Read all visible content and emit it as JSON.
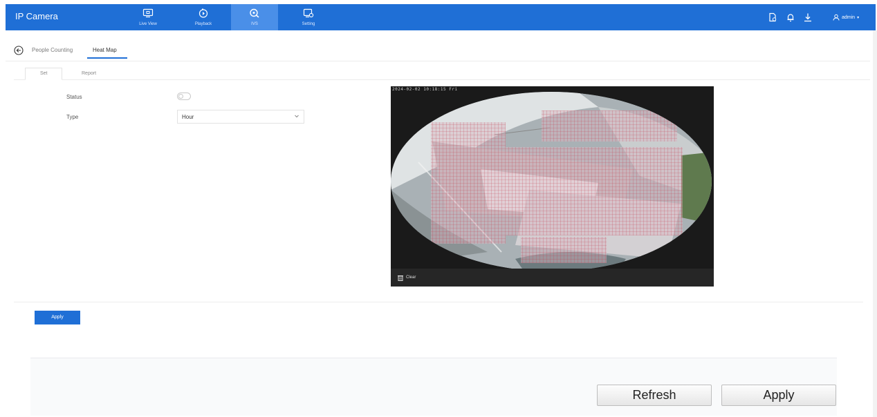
{
  "app": {
    "title": "IP Camera"
  },
  "nav": [
    {
      "label": "Live View",
      "icon": "monitor-icon",
      "active": false
    },
    {
      "label": "Playback",
      "icon": "playback-icon",
      "active": false
    },
    {
      "label": "IVS",
      "icon": "ivs-icon",
      "active": true
    },
    {
      "label": "Setting",
      "icon": "setting-icon",
      "active": false
    }
  ],
  "header_icons": [
    "file-icon",
    "bell-icon",
    "download-icon"
  ],
  "user": {
    "name": "admin",
    "icon": "user-icon"
  },
  "breadcrumb": {
    "items": [
      "People Counting",
      "Heat Map"
    ],
    "active": "Heat Map"
  },
  "subtabs": {
    "items": [
      "Set",
      "Report"
    ],
    "active": "Set"
  },
  "form": {
    "status_label": "Status",
    "status_on": false,
    "type_label": "Type",
    "type_value": "Hour"
  },
  "video": {
    "timestamp": "2024-02-02 10:18:15 Fri",
    "clear_label": "Clear"
  },
  "apply_label": "Apply",
  "footer": {
    "refresh_label": "Refresh",
    "apply_label": "Apply"
  },
  "colors": {
    "header": "#1f6fd6",
    "active_nav": "#4a8fe8",
    "grid": "#c23a4a"
  }
}
